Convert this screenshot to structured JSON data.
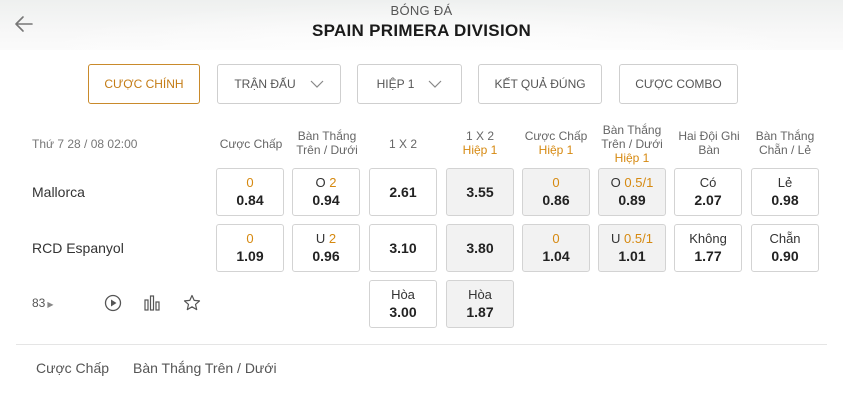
{
  "header": {
    "subtitle": "BÓNG ĐÁ",
    "title": "SPAIN PRIMERA DIVISION"
  },
  "tabs": [
    {
      "label": "CƯỢC CHÍNH",
      "active": true
    },
    {
      "label": "TRẬN ĐẤU",
      "dropdown": true
    },
    {
      "label": "HIỆP 1",
      "dropdown": true
    },
    {
      "label": "KẾT QUẢ ĐÚNG"
    },
    {
      "label": "CƯỢC COMBO"
    }
  ],
  "match": {
    "datetime": "Thứ 7 28 / 08 02:00",
    "home": "Mallorca",
    "away": "RCD Espanyol",
    "more_count": "83"
  },
  "columns": [
    {
      "line1": "Cược Chấp",
      "line2": "",
      "line3": ""
    },
    {
      "line1": "Bàn Thắng",
      "line2": "Trên / Dưới",
      "line3": ""
    },
    {
      "line1": "1 X 2",
      "line2": "",
      "line3": ""
    },
    {
      "line1": "1 X 2",
      "line2": "Hiệp 1",
      "line3": ""
    },
    {
      "line1": "Cược Chấp",
      "line2": "Hiệp 1",
      "line3": ""
    },
    {
      "line1": "Bàn Thắng",
      "line2": "Trên / Dưới",
      "line3": "Hiệp 1"
    },
    {
      "line1": "Hai Đội Ghi",
      "line2": "Bàn",
      "line3": ""
    },
    {
      "line1": "Bàn Thắng",
      "line2": "Chẵn / Lẻ",
      "line3": ""
    }
  ],
  "odds": {
    "home": {
      "handicap": {
        "line": "0",
        "odd": "0.84"
      },
      "ou": {
        "prefix": "O",
        "line": "2",
        "odd": "0.94"
      },
      "x12": {
        "odd": "2.61"
      },
      "x12_h1": {
        "odd": "3.55"
      },
      "handicap_h1": {
        "line": "0",
        "odd": "0.86"
      },
      "ou_h1": {
        "prefix": "O",
        "line": "0.5/1",
        "odd": "0.89"
      },
      "btts": {
        "label": "Có",
        "odd": "2.07"
      },
      "oddeven": {
        "label": "Lẻ",
        "odd": "0.98"
      }
    },
    "away": {
      "handicap": {
        "line": "0",
        "odd": "1.09"
      },
      "ou": {
        "prefix": "U",
        "line": "2",
        "odd": "0.96"
      },
      "x12": {
        "odd": "3.10"
      },
      "x12_h1": {
        "odd": "3.80"
      },
      "handicap_h1": {
        "line": "0",
        "odd": "1.04"
      },
      "ou_h1": {
        "prefix": "U",
        "line": "0.5/1",
        "odd": "1.01"
      },
      "btts": {
        "label": "Không",
        "odd": "1.77"
      },
      "oddeven": {
        "label": "Chẵn",
        "odd": "0.90"
      }
    },
    "draw": {
      "x12": {
        "label": "Hòa",
        "odd": "3.00"
      },
      "x12_h1": {
        "label": "Hòa",
        "odd": "1.87"
      }
    }
  },
  "bottom_tabs": [
    "Cược Chấp",
    "Bàn Thắng Trên / Dưới"
  ],
  "colors": {
    "accent": "#d68910",
    "border": "#d3d3d3"
  },
  "icons": [
    "back-arrow-icon",
    "play-icon",
    "stats-icon",
    "star-icon",
    "chevron-down-icon"
  ]
}
